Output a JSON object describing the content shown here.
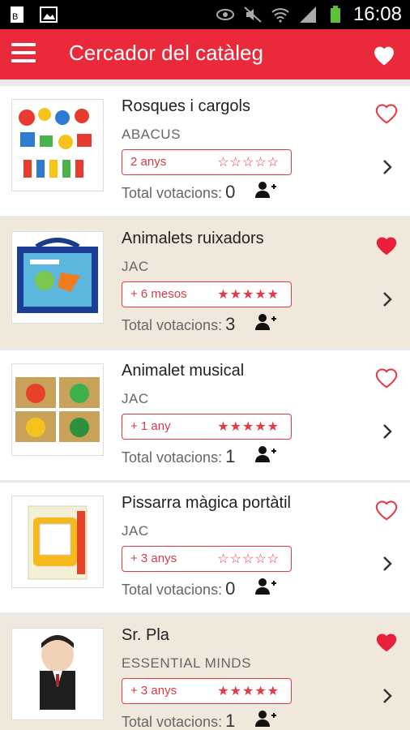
{
  "status_bar": {
    "time": "16:08"
  },
  "app_bar": {
    "title": "Cercador del catàleg"
  },
  "colors": {
    "accent": "#ea2a3a",
    "beige": "#efe8db",
    "white": "#ffffff"
  },
  "labels": {
    "total_votes": "Total votacions:"
  },
  "items": [
    {
      "title": "Rosques i cargols",
      "maker": "ABACUS",
      "age": "2 anys",
      "stars": "☆☆☆☆☆",
      "votes": "0",
      "favorite": false,
      "bg": "white"
    },
    {
      "title": "Animalets ruixadors",
      "maker": "JAC",
      "age": "+ 6 mesos",
      "stars": "★★★★★",
      "votes": "3",
      "favorite": true,
      "bg": "beige"
    },
    {
      "title": "Animalet musical",
      "maker": "JAC",
      "age": "+ 1 any",
      "stars": "★★★★★",
      "votes": "1",
      "favorite": false,
      "bg": "white"
    },
    {
      "title": "Pissarra màgica portàtil",
      "maker": "JAC",
      "age": "+ 3 anys",
      "stars": "☆☆☆☆☆",
      "votes": "0",
      "favorite": false,
      "bg": "white"
    },
    {
      "title": "Sr. Pla",
      "maker": "ESSENTIAL MINDS",
      "age": "+ 3 anys",
      "stars": "★★★★★",
      "votes": "1",
      "favorite": true,
      "bg": "beige"
    }
  ]
}
